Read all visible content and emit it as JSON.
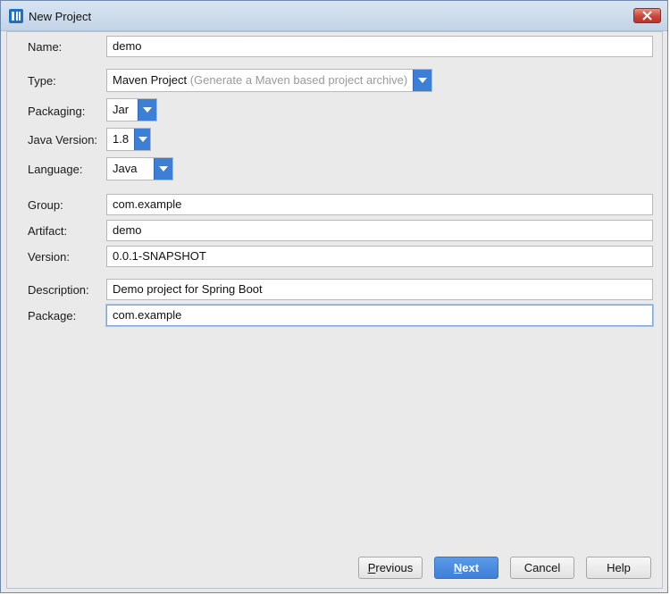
{
  "window": {
    "title": "New Project"
  },
  "form": {
    "name": {
      "label": "Name:",
      "value": "demo"
    },
    "type": {
      "label": "Type:",
      "value": "Maven Project",
      "hint": "(Generate a Maven based project archive)"
    },
    "packaging": {
      "label": "Packaging:",
      "value": "Jar"
    },
    "java_version": {
      "label": "Java Version:",
      "value": "1.8"
    },
    "language": {
      "label": "Language:",
      "value": "Java"
    },
    "group": {
      "label": "Group:",
      "value": "com.example"
    },
    "artifact": {
      "label": "Artifact:",
      "value": "demo"
    },
    "version": {
      "label": "Version:",
      "value": "0.0.1-SNAPSHOT"
    },
    "description": {
      "label": "Description:",
      "value": "Demo project for Spring Boot"
    },
    "package": {
      "label": "Package:",
      "value": "com.example"
    }
  },
  "buttons": {
    "previous_first": "P",
    "previous_rest": "revious",
    "next_first": "N",
    "next_rest": "ext",
    "cancel": "Cancel",
    "help": "Help"
  },
  "colors": {
    "accent": "#3e7fd6",
    "close_button": "#c8473a"
  },
  "icons": {
    "app": "intellij-icon",
    "close": "close-icon",
    "dropdown": "chevron-down-icon"
  }
}
